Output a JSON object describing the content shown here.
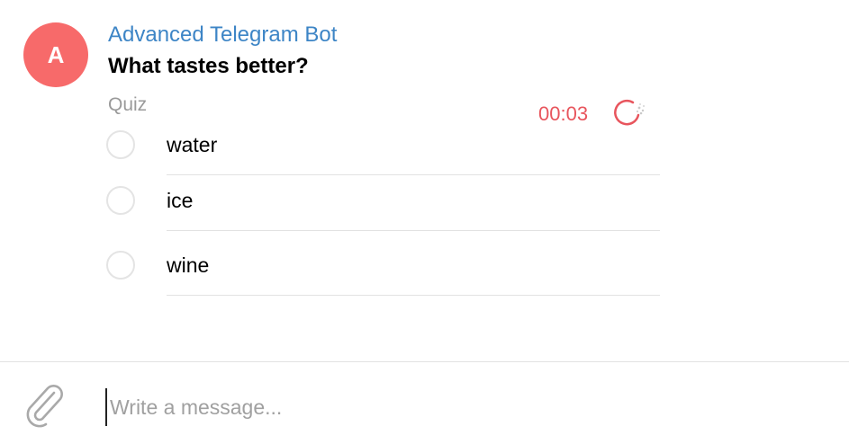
{
  "message": {
    "avatar_letter": "A",
    "avatar_color": "#f76a6a",
    "sender_name": "Advanced Telegram Bot",
    "sender_color": "#3d85c6",
    "question": "What tastes better?",
    "poll_type": "Quiz",
    "timer": "00:03",
    "timer_color": "#e8555d",
    "timer_icon": "countdown-icon",
    "options": [
      {
        "label": "water"
      },
      {
        "label": "ice"
      },
      {
        "label": "wine"
      }
    ]
  },
  "composer": {
    "attach_icon": "paperclip-icon",
    "placeholder": "Write a message..."
  }
}
